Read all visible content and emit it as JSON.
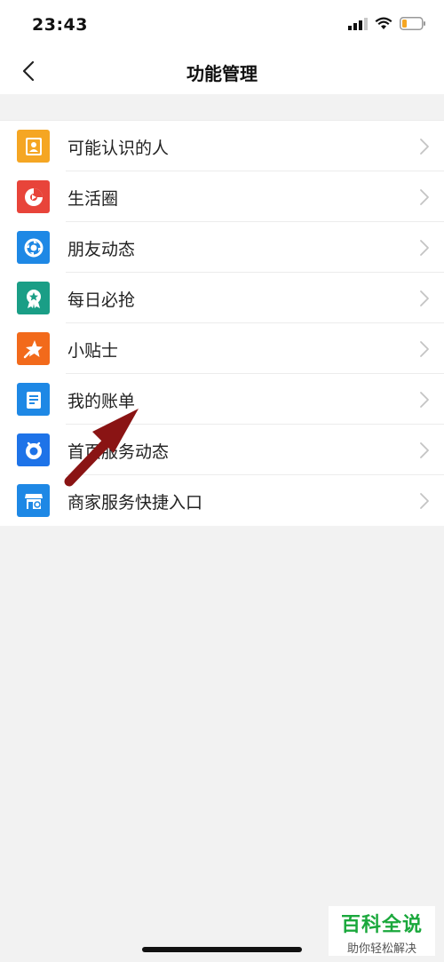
{
  "status": {
    "time": "23:43",
    "icons": [
      "signal-icon",
      "wifi-icon",
      "battery-icon"
    ]
  },
  "nav": {
    "title": "功能管理",
    "back_icon": "chevron-left-icon"
  },
  "items": [
    {
      "label": "可能认识的人",
      "icon": "contacts-icon",
      "color": "#f5a623"
    },
    {
      "label": "生活圈",
      "icon": "circle-life-icon",
      "color": "#e8443a"
    },
    {
      "label": "朋友动态",
      "icon": "friends-dynamic-icon",
      "color": "#1e88e5"
    },
    {
      "label": "每日必抢",
      "icon": "daily-badge-icon",
      "color": "#1a9e86"
    },
    {
      "label": "小贴士",
      "icon": "tips-star-icon",
      "color": "#f26a1b"
    },
    {
      "label": "我的账单",
      "icon": "bill-icon",
      "color": "#1e88e5"
    },
    {
      "label": "首页服务动态",
      "icon": "service-dynamic-icon",
      "color": "#1e73e8"
    },
    {
      "label": "商家服务快捷入口",
      "icon": "merchant-store-icon",
      "color": "#1e88e5"
    }
  ],
  "watermark": {
    "title": "百科全说",
    "subtitle": "助你轻松解决"
  },
  "annotation": {
    "arrow_color": "#8a1414",
    "arrow_icon": "pointer-arrow-icon"
  }
}
